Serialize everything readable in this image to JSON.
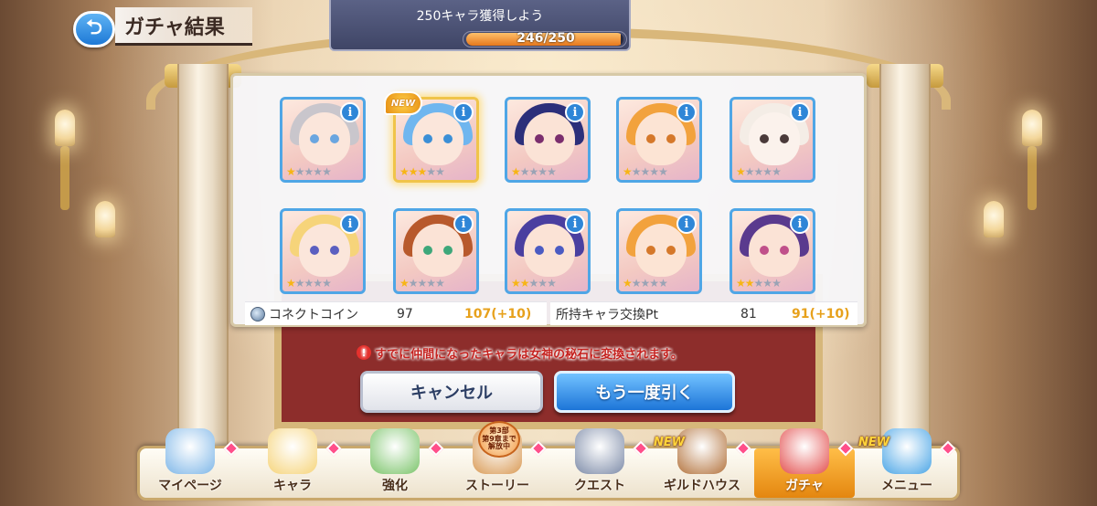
{
  "header": {
    "back_icon": "back-arrow-icon",
    "title": "ガチャ結果"
  },
  "mission": {
    "title": "250キャラ獲得しよう",
    "progress_text": "246/250",
    "progress_fraction": 0.984
  },
  "results": {
    "new_label": "NEW",
    "cards": [
      {
        "name": "character-1",
        "stars": 1,
        "featured": false,
        "hair": "#c9c6cc",
        "skin": "#fbe6db",
        "eye": "#6aa6e0"
      },
      {
        "name": "character-2",
        "stars": 3,
        "featured": true,
        "hair": "#6fb6ef",
        "skin": "#fbe6db",
        "eye": "#3b8fd6"
      },
      {
        "name": "character-3",
        "stars": 1,
        "featured": false,
        "hair": "#2c2f7a",
        "skin": "#fbe3d6",
        "eye": "#7b2e6e"
      },
      {
        "name": "character-4",
        "stars": 1,
        "featured": false,
        "hair": "#f2a23d",
        "skin": "#fce4d4",
        "eye": "#d5782a"
      },
      {
        "name": "character-5",
        "stars": 1,
        "featured": false,
        "hair": "#f4ede6",
        "skin": "#fbf2ec",
        "eye": "#4a3a3a"
      },
      {
        "name": "character-6",
        "stars": 1,
        "featured": false,
        "hair": "#f6d47a",
        "skin": "#fbe6db",
        "eye": "#5b5fc0"
      },
      {
        "name": "character-7",
        "stars": 1,
        "featured": false,
        "hair": "#b8592c",
        "skin": "#fbe3d6",
        "eye": "#3ea77a"
      },
      {
        "name": "character-8",
        "stars": 2,
        "featured": false,
        "hair": "#4a3fa0",
        "skin": "#fbe3d6",
        "eye": "#4b5bc2"
      },
      {
        "name": "character-9",
        "stars": 1,
        "featured": false,
        "hair": "#f2a23d",
        "skin": "#fce4d4",
        "eye": "#d5782a"
      },
      {
        "name": "character-10",
        "stars": 2,
        "featured": false,
        "hair": "#5a3a8e",
        "skin": "#fbe3d6",
        "eye": "#c0508a"
      }
    ],
    "info_label": "i",
    "max_stars": 5
  },
  "summary": {
    "coin_label": "コネクトコイン",
    "coin_old": "97",
    "coin_new": "107(+10)",
    "pt_label": "所持キャラ交換Pt",
    "pt_old": "81",
    "pt_new": "91(+10)"
  },
  "notice": {
    "icon": "!",
    "text": "すでに仲間になったキャラは女神の秘石に変換されます。"
  },
  "buttons": {
    "cancel": "キャンセル",
    "again": "もう一度引く"
  },
  "nav": {
    "items": [
      {
        "label": "マイページ",
        "color": "#7fb7e8",
        "new": false
      },
      {
        "label": "キャラ",
        "color": "#f6d47a",
        "new": false
      },
      {
        "label": "強化",
        "color": "#7bc46a",
        "new": false
      },
      {
        "label": "ストーリー",
        "color": "#d99a55",
        "new": false
      },
      {
        "label": "クエスト",
        "color": "#7d8ba8",
        "new": false
      },
      {
        "label": "ギルドハウス",
        "color": "#b3733d",
        "new": true
      },
      {
        "label": "ガチャ",
        "color": "#e3504f",
        "new": false,
        "active": true
      },
      {
        "label": "メニュー",
        "color": "#4aa5e6",
        "new": true
      }
    ],
    "new_label": "NEW",
    "story_badge": {
      "line1": "第3部",
      "line2": "第9章まで",
      "line3": "解放中"
    }
  },
  "colors": {
    "accent_blue": "#1d75d8",
    "accent_orange": "#e4860f",
    "warning_red": "#c5221f",
    "gain_gold": "#e7a11c"
  }
}
